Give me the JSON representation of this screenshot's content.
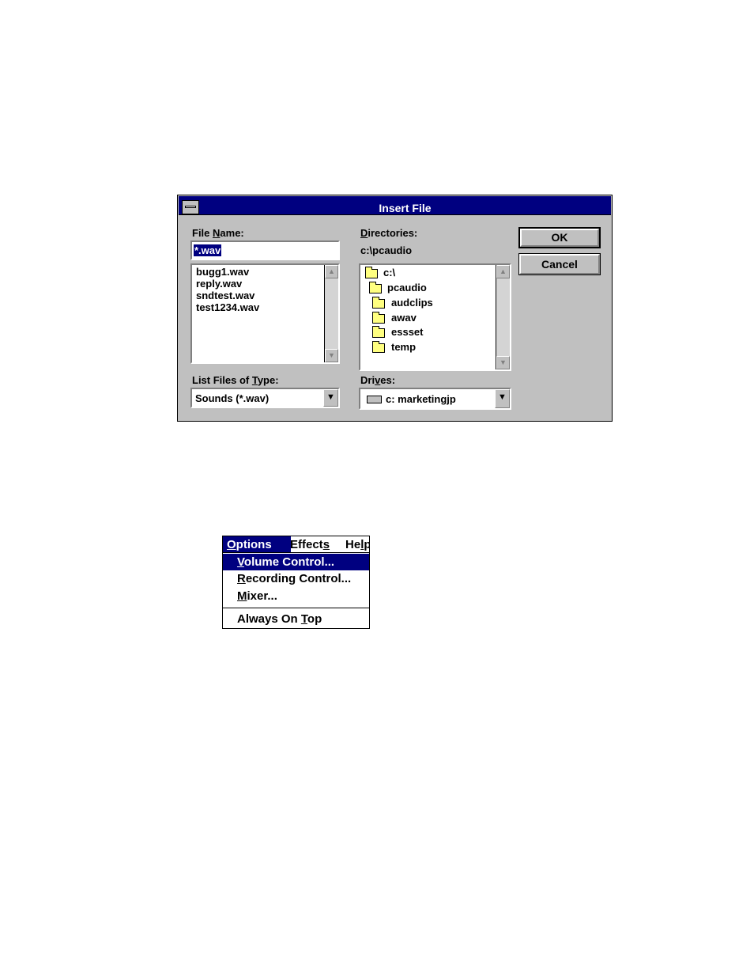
{
  "dialog": {
    "title": "Insert File",
    "file_name_label_pre": "File ",
    "file_name_label_u": "N",
    "file_name_label_post": "ame:",
    "file_name_value": "*.wav",
    "files": [
      "bugg1.wav",
      "reply.wav",
      "sndtest.wav",
      "test1234.wav"
    ],
    "type_label_pre": "List Files of ",
    "type_label_u": "T",
    "type_label_post": "ype:",
    "type_value": "Sounds (*.wav)",
    "directories_label_u": "D",
    "directories_label_post": "irectories:",
    "current_dir": "c:\\pcaudio",
    "dirs": [
      "c:\\",
      "pcaudio",
      "audclips",
      "awav",
      "essset",
      "temp"
    ],
    "drives_label_pre": "Dri",
    "drives_label_u": "v",
    "drives_label_post": "es:",
    "drive_value": "c: marketingjp",
    "ok_label": "OK",
    "cancel_label": "Cancel"
  },
  "menu": {
    "bar": [
      {
        "u": "O",
        "rest": "ptions"
      },
      {
        "pre": "Effect",
        "u": "s",
        "rest": ""
      },
      {
        "pre": "He",
        "u": "l",
        "rest": "p"
      }
    ],
    "items": [
      {
        "u": "V",
        "rest": "olume Control..."
      },
      {
        "u": "R",
        "rest": "ecording Control..."
      },
      {
        "u": "M",
        "rest": "ixer..."
      },
      {
        "pre": "Always On ",
        "u": "T",
        "rest": "op"
      }
    ]
  },
  "icons": {
    "scroll_up": "scroll-up-arrow-icon",
    "scroll_down": "scroll-down-arrow-icon",
    "dropdown": "dropdown-arrow-icon",
    "folder": "folder-icon",
    "open_folder": "open-folder-icon",
    "drive": "hard-drive-icon",
    "system_menu": "system-menu-icon"
  },
  "colors": {
    "title_bar": "#000080",
    "dialog_face": "#c0c0c0",
    "highlight": "#000080"
  }
}
